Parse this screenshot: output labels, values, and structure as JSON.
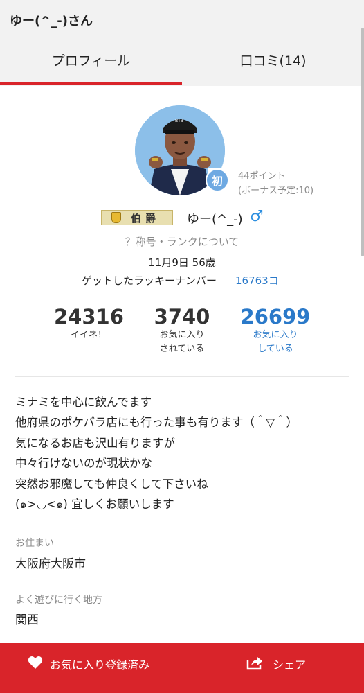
{
  "header": {
    "title": "ゆー(^_-)さん",
    "tabs": [
      {
        "label": "プロフィール",
        "active": true
      },
      {
        "label": "口コミ(14)",
        "active": false
      }
    ]
  },
  "profile": {
    "avatar_initial_badge": "初",
    "points": "44ポイント",
    "bonus": "(ボーナス予定:10)",
    "rank_title": "伯爵",
    "username": "ゆー(^_-)",
    "gender_symbol": "♂",
    "rank_link": "？称号・ランクについて",
    "birth_age": "11月9日 56歳",
    "lucky_label": "ゲットしたラッキーナンバー",
    "lucky_number": "16763コ"
  },
  "stats": [
    {
      "number": "24316",
      "label_line1": "イイネ！",
      "label_line2": ""
    },
    {
      "number": "3740",
      "label_line1": "お気に入り",
      "label_line2": "されている"
    },
    {
      "number": "26699",
      "label_line1": "お気に入り",
      "label_line2": "している"
    }
  ],
  "bio_lines": [
    "ミナミを中心に飲んでます",
    "他府県のポケパラ店にも行った事も有ります（＾▽＾）",
    "気になるお店も沢山有りますが",
    "中々行けないのが現状かな",
    "突然お邪魔しても仲良くして下さいね",
    "(๑>◡<๑) 宜しくお願いします"
  ],
  "details": {
    "residence_label": "お住まい",
    "residence_value": "大阪府大阪市",
    "area_label": "よく遊びに行く地方",
    "area_value": "関西"
  },
  "footer": {
    "favorite_label": "お気に入り登録済み",
    "share_label": "シェア"
  },
  "colors": {
    "accent_red": "#d9242a",
    "link_blue": "#2a79c9",
    "gender_blue": "#2d8fe0",
    "avatar_bg": "#8cbfe9"
  }
}
